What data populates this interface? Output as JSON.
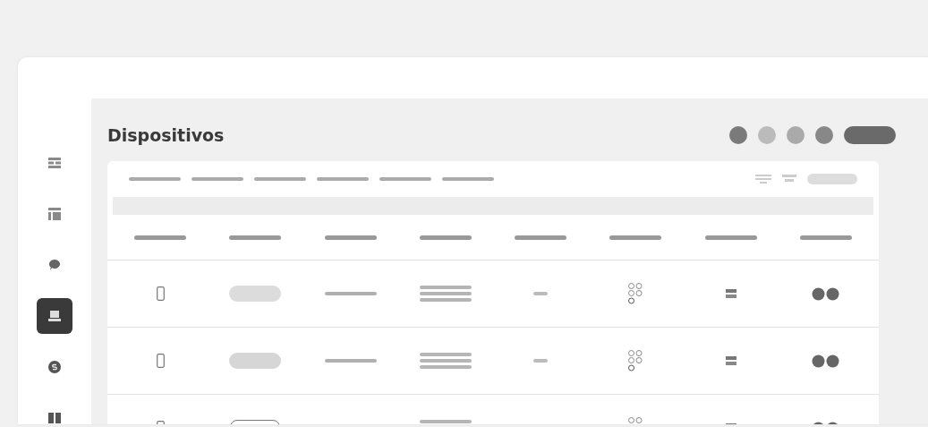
{
  "page": {
    "title": "Dispositivos"
  },
  "sidebar": {
    "items": [
      {
        "selected": false
      },
      {
        "selected": false
      },
      {
        "selected": false
      },
      {
        "selected": true
      },
      {
        "selected": false
      },
      {
        "selected": false
      }
    ]
  }
}
